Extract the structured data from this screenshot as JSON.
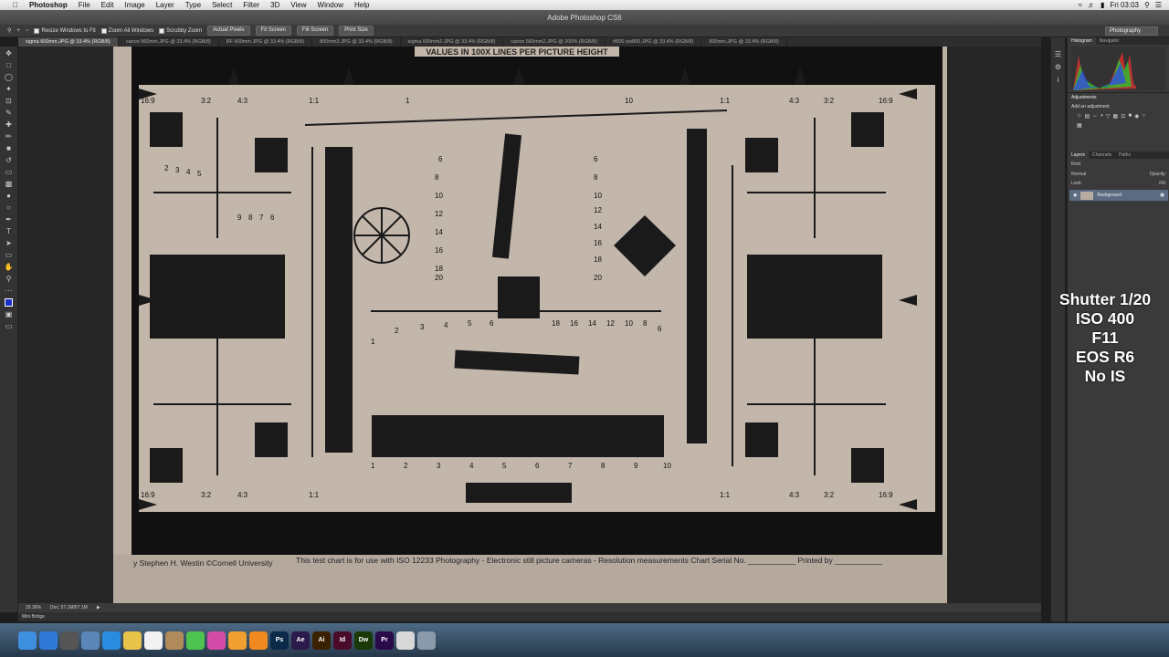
{
  "menubar": {
    "apple": "",
    "app_name": "Photoshop",
    "items": [
      "File",
      "Edit",
      "Image",
      "Layer",
      "Type",
      "Select",
      "Filter",
      "3D",
      "View",
      "Window",
      "Help"
    ],
    "clock": "Fri 03:03"
  },
  "window": {
    "title": "Adobe Photoshop CS6"
  },
  "options": {
    "resize_windows": "Resize Windows to Fit",
    "zoom_all": "Zoom All Windows",
    "scrubby": "Scrubby Zoom",
    "actual_pixels": "Actual Pixels",
    "fit_screen": "Fit Screen",
    "fill_screen": "Fill Screen",
    "print_size": "Print Size",
    "workspace": "Photography"
  },
  "tabs": [
    "sigma 600mm.JPG @ 33.4% (RGB/8)",
    "canon 560mm.JPG @ 33.4% (RGB/8)",
    "RF 600mm.JPG @ 33.4% (RGB/8)",
    "800mm3.JPG @ 33.4% (RGB/8)",
    "sigma 600mm2.JPG @ 33.4% (RGB/8)",
    "canon 560mm2.JPG @ 200% (RGB/8)",
    "rf600 iso800.JPG @ 33.4% (RGB/8)",
    "800mm.JPG @ 33.4% (RGB/8)"
  ],
  "chart": {
    "header": "VALUES IN 100X LINES PER PICTURE HEIGHT",
    "ratio_labels": [
      "16:9",
      "3:2",
      "4:3",
      "1:1",
      "1:1",
      "4:3",
      "3:2",
      "16:9"
    ],
    "top_scale": [
      "1",
      "10"
    ],
    "fan_left_nums": [
      "2",
      "3",
      "4",
      "5",
      "9",
      "8",
      "7",
      "6"
    ],
    "center_left_nums": [
      "6",
      "8",
      "10",
      "12",
      "14",
      "16",
      "18",
      "20"
    ],
    "center_right_nums": [
      "6",
      "8",
      "10",
      "12",
      "14",
      "16",
      "18",
      "20"
    ],
    "horiz_bottom_nums": [
      "1",
      "2",
      "3",
      "4",
      "5",
      "6",
      "7",
      "8",
      "9",
      "10"
    ],
    "horiz_mid_left": [
      "1",
      "2",
      "3",
      "4",
      "5",
      "6"
    ],
    "horiz_mid_right": [
      "18",
      "16",
      "14",
      "12",
      "10",
      "8",
      "6"
    ],
    "footer_left": "y Stephen H. Westin  ©Cornell University",
    "footer_right": "This test chart is for use with ISO 12233 Photography - Electronic still picture cameras - Resolution measurements Chart Serial No. ___________ Printed by ___________"
  },
  "status": {
    "zoom": "33.36%",
    "doc": "Doc: 57.1M/57.1M"
  },
  "minibridge": "Mini Bridge",
  "panels": {
    "histogram_tab": "Histogram",
    "navigator_tab": "Navigator",
    "adjustments_title": "Adjustments",
    "add_adjustment": "Add an adjustment",
    "layers_tab": "Layers",
    "channels_tab": "Channels",
    "paths_tab": "Paths",
    "kind": "Kind",
    "blend": "Normal",
    "opacity": "Opacity:",
    "lock": "Lock:",
    "fill": "Fill:",
    "layer_name": "Background"
  },
  "overlay": {
    "line1": "Shutter 1/20",
    "line2": "ISO 400",
    "line3": "F11",
    "line4": "EOS R6",
    "line5": "No IS"
  },
  "dock": [
    {
      "name": "Finder",
      "color": "#3f8fe0"
    },
    {
      "name": "Safari",
      "color": "#2f7ad8"
    },
    {
      "name": "Mission Control",
      "color": "#555"
    },
    {
      "name": "Preview",
      "color": "#5b86b8"
    },
    {
      "name": "App Store",
      "color": "#2a8ce0"
    },
    {
      "name": "Notes",
      "color": "#e8c34a"
    },
    {
      "name": "Calendar",
      "color": "#f2f2f2"
    },
    {
      "name": "Contacts",
      "color": "#b08a5a"
    },
    {
      "name": "Messages",
      "color": "#4fc34f"
    },
    {
      "name": "iTunes",
      "color": "#d54ba8"
    },
    {
      "name": "Photos",
      "color": "#f0a030"
    },
    {
      "name": "VLC",
      "color": "#f08a20"
    },
    {
      "name": "Ps",
      "color": "#0b2a4a"
    },
    {
      "name": "Ae",
      "color": "#2b1a4a"
    },
    {
      "name": "Ai",
      "color": "#3a2200"
    },
    {
      "name": "Id",
      "color": "#4a0a2a"
    },
    {
      "name": "Dw",
      "color": "#1a3a0a"
    },
    {
      "name": "Pr",
      "color": "#2a0a4a"
    },
    {
      "name": "Chrome",
      "color": "#d8d8d8"
    },
    {
      "name": "Trash",
      "color": "#8a9aaa"
    }
  ]
}
